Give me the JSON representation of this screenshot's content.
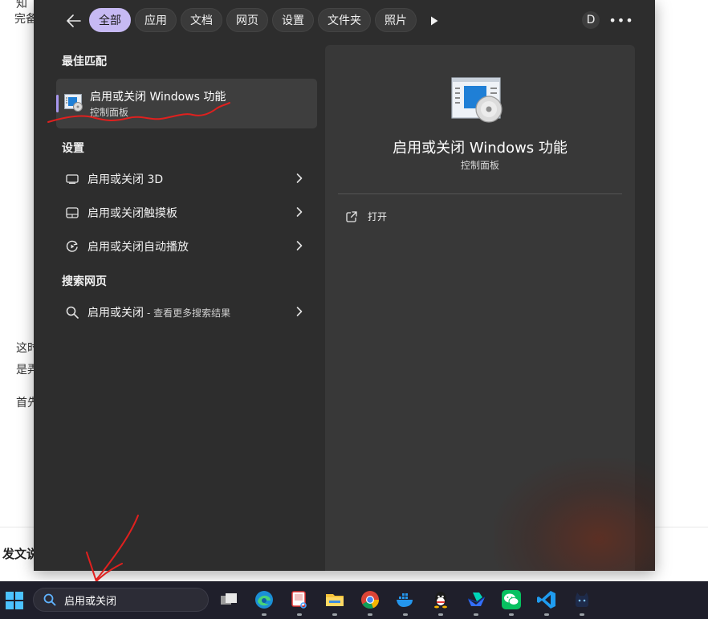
{
  "background": {
    "line1": "知",
    "line2": "完备",
    "line3": "这时",
    "line4": "是弄",
    "line5": "首先",
    "footer": "发文说"
  },
  "topbar": {
    "tabs": [
      {
        "label": "全部",
        "active": true
      },
      {
        "label": "应用"
      },
      {
        "label": "文档"
      },
      {
        "label": "网页"
      },
      {
        "label": "设置"
      },
      {
        "label": "文件夹"
      },
      {
        "label": "照片"
      }
    ],
    "avatar_letter": "D",
    "more_label": "•••"
  },
  "results": {
    "best_match_heading": "最佳匹配",
    "best_match": {
      "title": "启用或关闭 Windows 功能",
      "subtitle": "控制面板"
    },
    "settings_heading": "设置",
    "settings_items": [
      {
        "label": "启用或关闭 3D",
        "icon": "display-icon"
      },
      {
        "label": "启用或关闭触摸板",
        "icon": "touchpad-icon"
      },
      {
        "label": "启用或关闭自动播放",
        "icon": "autoplay-icon"
      }
    ],
    "web_heading": "搜索网页",
    "web_item": {
      "label": "启用或关闭",
      "suffix": "- 查看更多搜索结果"
    }
  },
  "detail": {
    "title": "启用或关闭 Windows 功能",
    "subtitle": "控制面板",
    "open_label": "打开"
  },
  "taskbar": {
    "search_value": "启用或关闭",
    "apps": [
      "task-view",
      "edge",
      "snipping-tool",
      "file-explorer",
      "chrome",
      "docker",
      "qq",
      "feishu",
      "wechat",
      "vscode",
      "app-cat"
    ]
  },
  "colors": {
    "panel_bg": "#2d2d2d",
    "detail_bg": "#383838",
    "accent": "#c6b9f3",
    "taskbar_bg": "#1f1f2b",
    "annotation": "#e0201e"
  }
}
